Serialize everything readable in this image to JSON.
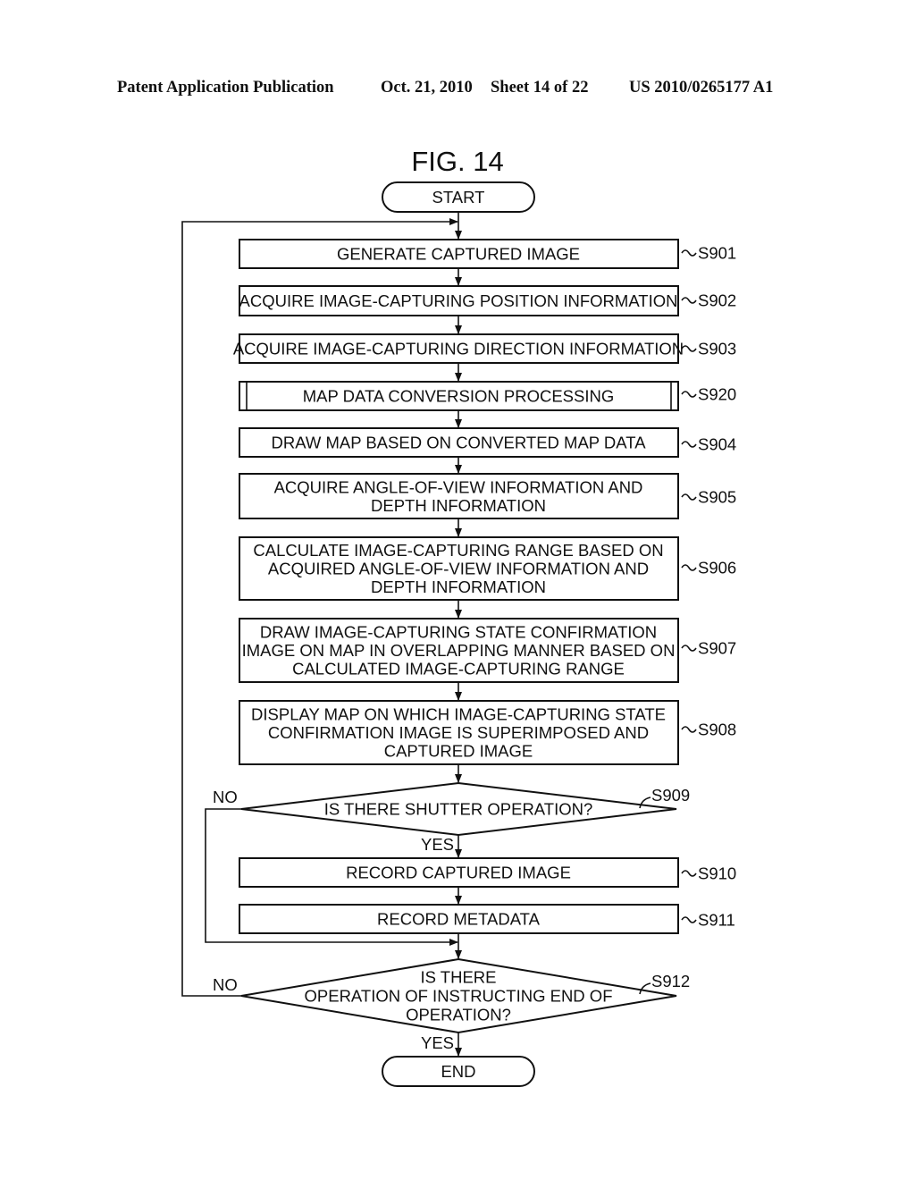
{
  "header": {
    "publication": "Patent Application Publication",
    "date": "Oct. 21, 2010",
    "sheet": "Sheet 14 of 22",
    "number": "US 2010/0265177 A1"
  },
  "figure": {
    "title": "FIG. 14"
  },
  "flowchart": {
    "start": "START",
    "end": "END",
    "steps": [
      {
        "id": "S901",
        "lines": [
          "GENERATE CAPTURED IMAGE"
        ]
      },
      {
        "id": "S902",
        "lines": [
          "ACQUIRE IMAGE-CAPTURING POSITION INFORMATION"
        ]
      },
      {
        "id": "S903",
        "lines": [
          "ACQUIRE IMAGE-CAPTURING DIRECTION INFORMATION"
        ]
      },
      {
        "id": "S920",
        "lines": [
          "MAP DATA CONVERSION PROCESSING"
        ],
        "subroutine": true
      },
      {
        "id": "S904",
        "lines": [
          "DRAW MAP BASED ON CONVERTED MAP DATA"
        ]
      },
      {
        "id": "S905",
        "lines": [
          "ACQUIRE ANGLE-OF-VIEW INFORMATION AND",
          "DEPTH INFORMATION"
        ]
      },
      {
        "id": "S906",
        "lines": [
          "CALCULATE IMAGE-CAPTURING RANGE BASED ON",
          "ACQUIRED ANGLE-OF-VIEW INFORMATION AND",
          "DEPTH INFORMATION"
        ]
      },
      {
        "id": "S907",
        "lines": [
          "DRAW IMAGE-CAPTURING STATE CONFIRMATION",
          "IMAGE ON MAP IN OVERLAPPING MANNER BASED ON",
          "CALCULATED IMAGE-CAPTURING RANGE"
        ]
      },
      {
        "id": "S908",
        "lines": [
          "DISPLAY MAP ON WHICH IMAGE-CAPTURING STATE",
          "CONFIRMATION IMAGE IS SUPERIMPOSED AND",
          "CAPTURED IMAGE"
        ]
      },
      {
        "id": "S910",
        "lines": [
          "RECORD CAPTURED IMAGE"
        ]
      },
      {
        "id": "S911",
        "lines": [
          "RECORD METADATA"
        ]
      }
    ],
    "decisions": [
      {
        "id": "S909",
        "lines": [
          "IS THERE SHUTTER OPERATION?"
        ],
        "yes": "YES",
        "no": "NO"
      },
      {
        "id": "S912",
        "lines": [
          "IS THERE",
          "OPERATION OF INSTRUCTING END OF",
          "OPERATION?"
        ],
        "yes": "YES",
        "no": "NO"
      }
    ]
  }
}
